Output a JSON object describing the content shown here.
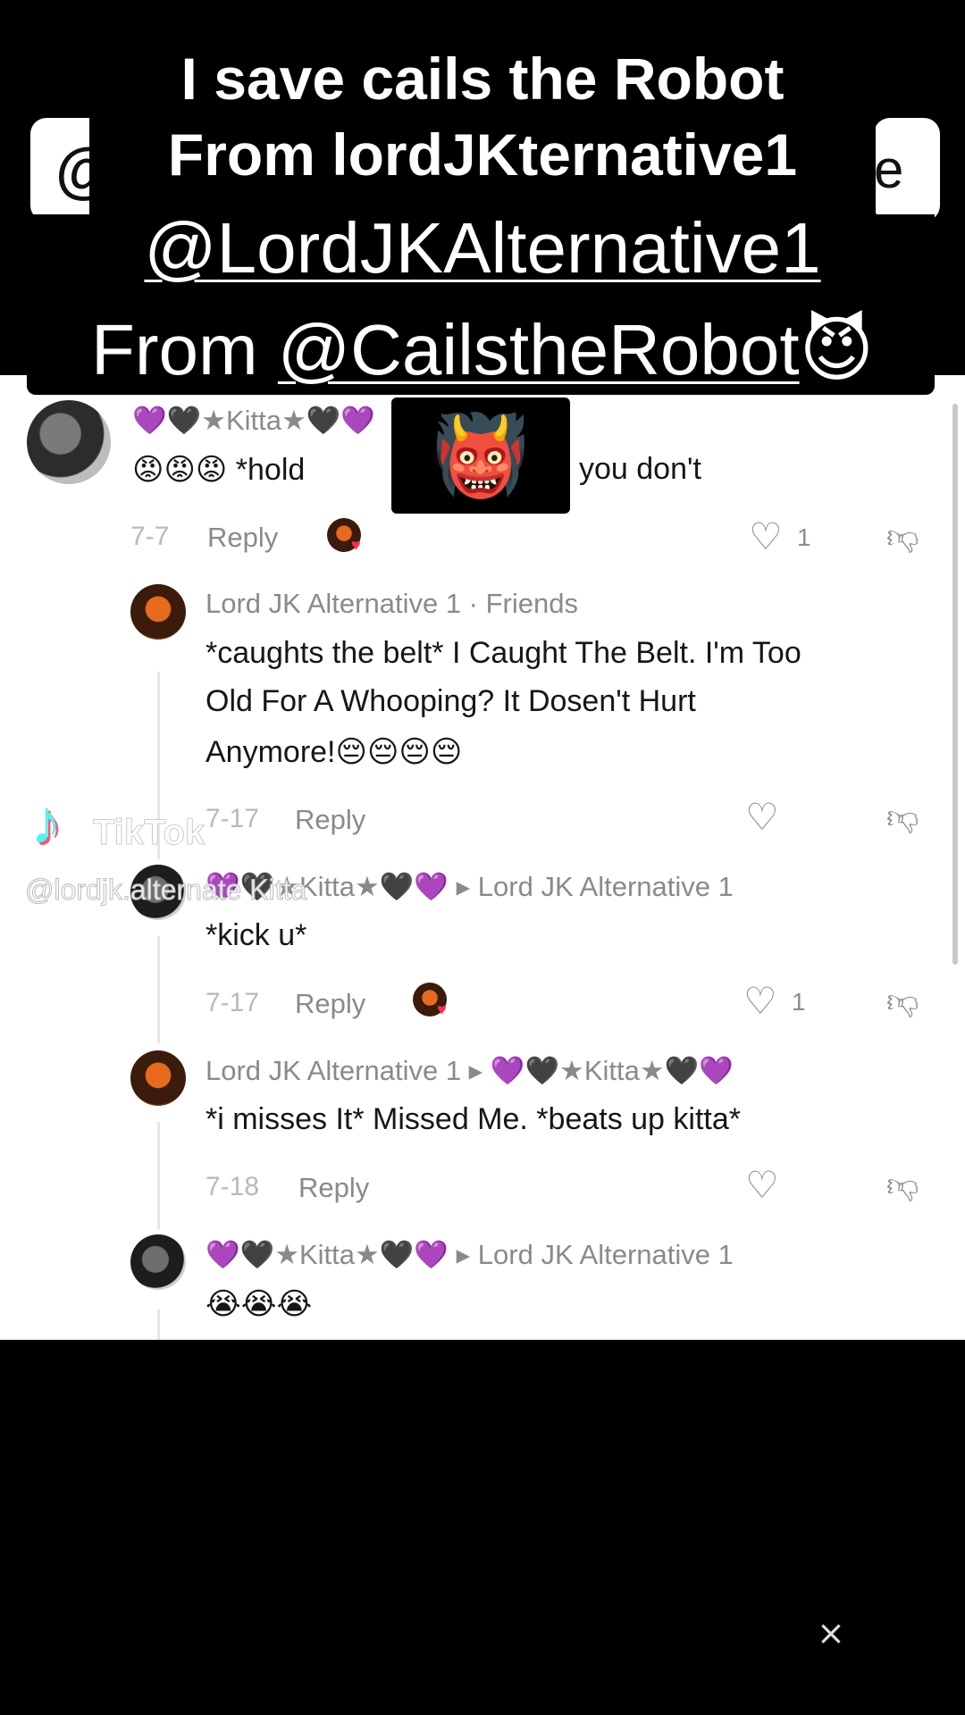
{
  "caption": {
    "line1": "I save cails the Robot",
    "line2": "From lordJKternative1",
    "line3": "@LordJKAlternative1",
    "line4_prefix": "From ",
    "line4_handle": "@CailstheRobot",
    "line4_emoji": "😈"
  },
  "obscured_sticker": {
    "emoji": "👹"
  },
  "background_ghost": {
    "left_char": "@",
    "right_char": "e"
  },
  "comments": [
    {
      "name": "💜🖤★Kitta★🖤💜",
      "text_start": "😡😡😡 *hold",
      "text_end": "you don't",
      "date": "7-7",
      "reply": "Reply",
      "likes": "1"
    },
    {
      "name": "Lord JK Alternative 1 · Friends",
      "line1": "*caughts the belt* I Caught The Belt. I'm Too",
      "line2": "Old For A Whooping? It Dosen't Hurt",
      "line3": "Anymore!😔😔😔😔",
      "date": "7-17",
      "reply": "Reply"
    },
    {
      "name": "💜🖤★Kitta★🖤💜 ▸ Lord JK Alternative 1",
      "text": "*kick u*",
      "date": "7-17",
      "reply": "Reply",
      "likes": "1"
    },
    {
      "name": "Lord JK Alternative 1 ▸ 💜🖤★Kitta★🖤💜",
      "text": "*i misses It* Missed Me. *beats up kitta*",
      "date": "7-18",
      "reply": "Reply"
    },
    {
      "name": "💜🖤★Kitta★🖤💜 ▸ Lord JK Alternative 1",
      "text": "😭😭😭"
    }
  ],
  "watermark": {
    "logo": "♪",
    "brand": "TikTok",
    "handle": "@lordjk.alternate Kitta"
  },
  "icons": {
    "heart": "heart-outline-icon",
    "dislike": "thumbs-down-icon",
    "capcut": "capcut-icon"
  }
}
